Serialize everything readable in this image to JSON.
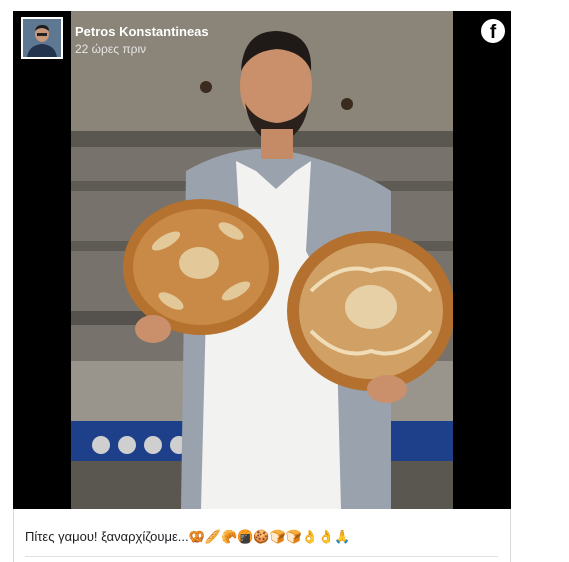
{
  "post": {
    "author": "Petros Konstantineas",
    "time": "22 ώρες πριν",
    "caption": "Πίτες γαμου! ξαναρχίζουμε...🥨🥖🥐🍘🍪🍞🍞👌👌🙏"
  },
  "icons": {
    "platform": "facebook-icon"
  }
}
